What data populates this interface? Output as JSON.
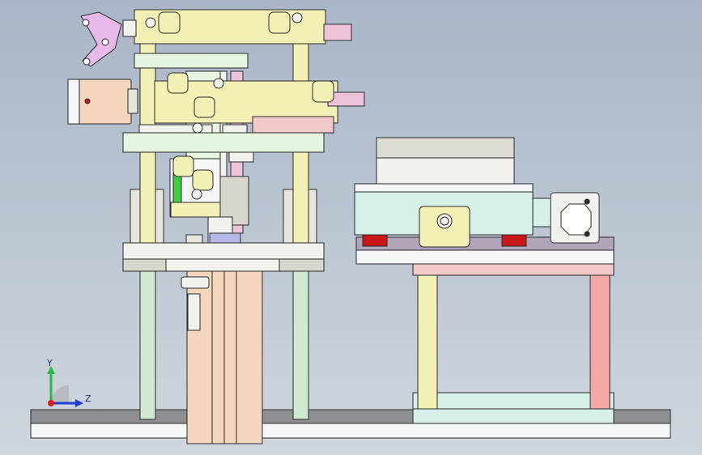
{
  "viewport": {
    "background_top": "#a9b6c7",
    "background_bottom": "#cfd6de"
  },
  "triad": {
    "y_label": "Y",
    "z_label": "Z",
    "y_color": "#2db34a",
    "z_color": "#1f3fd6",
    "x_color": "#d42020"
  },
  "palette": {
    "edge": "#2a2a2a",
    "base_plate": "#8d8f93",
    "base_plate_light": "#f4f6f8",
    "yellow_part": "#f2f0b4",
    "mint_part": "#e6f5df",
    "green_rod": "#cfe8cf",
    "gray_plate": "#d6d6cc",
    "cylinder_tan": "#f3d6bc",
    "pink_rod": "#eec2d8",
    "blue_green_part": "#d6efe8",
    "red_rod": "#f2a9a6",
    "clamp_pink": "#e8b9e8",
    "dark_red_mark": "#c81818",
    "gray_block": "#f1f1ed"
  }
}
